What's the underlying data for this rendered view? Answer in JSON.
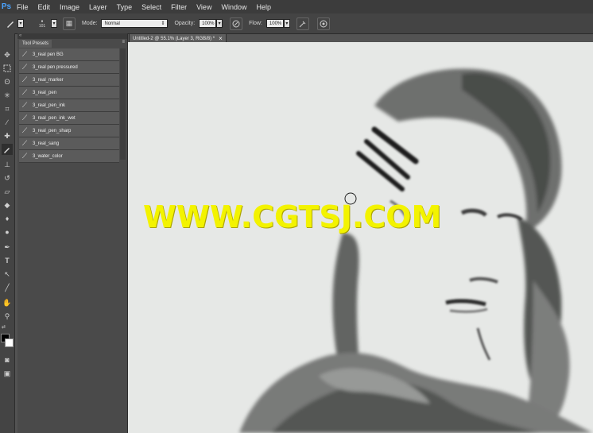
{
  "menubar": {
    "logo": "Ps",
    "items": [
      "File",
      "Edit",
      "Image",
      "Layer",
      "Type",
      "Select",
      "Filter",
      "View",
      "Window",
      "Help"
    ]
  },
  "options": {
    "brush_size": "101",
    "mode_label": "Mode:",
    "mode_value": "Normal",
    "opacity_label": "Opacity:",
    "opacity_value": "100%",
    "flow_label": "Flow:",
    "flow_value": "100%"
  },
  "panel": {
    "title": "Tool Presets",
    "presets": [
      "3_real pen BG",
      "3_real pen pressured",
      "3_real_marker",
      "3_real_pen",
      "3_real_pen_ink",
      "3_real_pen_ink_wet",
      "3_real_pen_sharp",
      "3_real_sang",
      "3_water_color"
    ]
  },
  "document": {
    "tab_title": "Untitled-2 @ 55.1% (Layer 3, RGB/8) *",
    "close": "×"
  },
  "watermark": "WWW.CGTSJ.COM",
  "colors": {
    "accent": "#4aa3ff",
    "watermark": "#f3f300",
    "canvas": "#e6e8e6"
  }
}
